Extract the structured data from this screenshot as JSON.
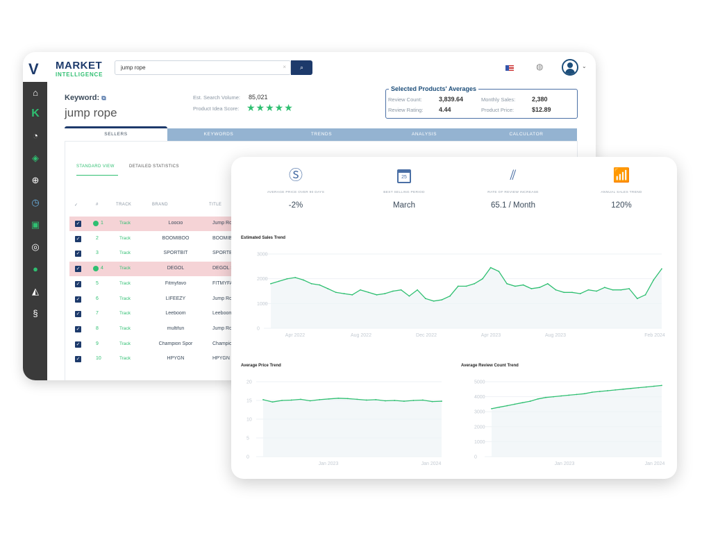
{
  "app": {
    "logo_line1": "MARKET",
    "logo_line2": "INTELLIGENCE"
  },
  "search": {
    "value": "jump rope",
    "clear_icon": "×",
    "search_icon": "magnifier"
  },
  "header": {
    "flag": "us-flag",
    "globe": "globe-icon",
    "avatar": "user-avatar"
  },
  "keyword": {
    "label": "Keyword:",
    "value": "jump rope",
    "est_search_volume_label": "Est. Search Volume:",
    "est_search_volume": "85,021",
    "product_idea_score_label": "Product Idea Score:",
    "stars": 5
  },
  "averages": {
    "title": "Selected Products' Averages",
    "review_count_label": "Review Count:",
    "review_count": "3,839.64",
    "review_rating_label": "Review Rating:",
    "review_rating": "4.44",
    "monthly_sales_label": "Monthly Sales:",
    "monthly_sales": "2,380",
    "product_price_label": "Product Price:",
    "product_price": "$12.89"
  },
  "tabs": [
    "SELLERS",
    "KEYWORDS",
    "TRENDS",
    "ANALYSIS",
    "CALCULATOR"
  ],
  "subtabs": [
    "STANDARD VIEW",
    "DETAILED STATISTICS"
  ],
  "table": {
    "headers": [
      "✓",
      "#",
      "TRACK",
      "BRAND",
      "TITLE"
    ],
    "rows": [
      {
        "n": "1",
        "track": "Track",
        "brand": "Loocio",
        "title": "Jump Rope, Tang",
        "flag": true
      },
      {
        "n": "2",
        "track": "Track",
        "brand": "BOOMIBOO",
        "title": "BOOMIBOO Jump",
        "flag": false
      },
      {
        "n": "3",
        "track": "Track",
        "brand": "SPORTBIT",
        "title": "SPORTBIT Adjust",
        "flag": false
      },
      {
        "n": "4",
        "track": "Track",
        "brand": "DEGOL",
        "title": "DEGOL Skipping",
        "flag": true
      },
      {
        "n": "5",
        "track": "Track",
        "brand": "Fitmyfavo",
        "title": "FITMYFAVO Jump",
        "flag": false
      },
      {
        "n": "6",
        "track": "Track",
        "brand": "LIFEEZY",
        "title": "Jump Rope, High",
        "flag": false
      },
      {
        "n": "7",
        "track": "Track",
        "brand": "Leeboom",
        "title": "Leeboom Jump R",
        "flag": false
      },
      {
        "n": "8",
        "track": "Track",
        "brand": "multifun",
        "title": "Jump Rope, mult",
        "flag": false
      },
      {
        "n": "9",
        "track": "Track",
        "brand": "Champion Spor",
        "title": "Champion Sports",
        "flag": false
      },
      {
        "n": "10",
        "track": "Track",
        "brand": "HPYGN",
        "title": "HPYGN Weighted",
        "flag": false
      }
    ]
  },
  "stats": [
    {
      "icon": "dollar-icon",
      "label": "AVERAGE PRICE OVER 90 DAYS",
      "value": "-2%"
    },
    {
      "icon": "calendar-icon",
      "label": "BEST SELLING PERIOD",
      "value": "March",
      "calendar_day": "25"
    },
    {
      "icon": "meteor-icon",
      "label": "RATE OF REVIEW INCREASE",
      "value": "65.1 / Month"
    },
    {
      "icon": "bar-growth-icon",
      "label": "ANNUAL SALES TREND",
      "value": "120%"
    }
  ],
  "colors": {
    "accent": "#2fbf71",
    "navy": "#1d3a6b",
    "tab_blue": "#94b3d1",
    "highlight_row": "#f5d3d6"
  },
  "chart_data": [
    {
      "type": "area",
      "title": "Estimated Sales Trend",
      "ylim": [
        0,
        3000
      ],
      "yticks": [
        "0",
        "1000",
        "2000",
        "3000"
      ],
      "xticks": [
        "Apr 2022",
        "Aug 2022",
        "Dec 2022",
        "Apr 2023",
        "Aug 2023",
        "Feb 2024"
      ],
      "grid": true,
      "x": [
        "Feb 2022",
        "Mar 2022",
        "Mar 2022",
        "Apr 2022",
        "Apr 2022",
        "May 2022",
        "May 2022",
        "Jun 2022",
        "Jun 2022",
        "Jul 2022",
        "Jul 2022",
        "Aug 2022",
        "Aug 2022",
        "Sep 2022",
        "Sep 2022",
        "Oct 2022",
        "Oct 2022",
        "Nov 2022",
        "Nov 2022",
        "Dec 2022",
        "Dec 2022",
        "Jan 2023",
        "Jan 2023",
        "Feb 2023",
        "Feb 2023",
        "Mar 2023",
        "Mar 2023",
        "Apr 2023",
        "Apr 2023",
        "May 2023",
        "May 2023",
        "Jun 2023",
        "Jun 2023",
        "Jul 2023",
        "Jul 2023",
        "Aug 2023",
        "Aug 2023",
        "Sep 2023",
        "Sep 2023",
        "Oct 2023",
        "Oct 2023",
        "Nov 2023",
        "Nov 2023",
        "Dec 2023",
        "Dec 2023",
        "Jan 2024",
        "Jan 2024",
        "Feb 2024",
        "Feb 2024"
      ],
      "values": [
        1800,
        1900,
        2000,
        2050,
        1950,
        1800,
        1750,
        1600,
        1450,
        1400,
        1350,
        1550,
        1450,
        1350,
        1400,
        1500,
        1550,
        1300,
        1550,
        1200,
        1100,
        1150,
        1300,
        1700,
        1700,
        1800,
        2000,
        2450,
        2300,
        1800,
        1700,
        1750,
        1600,
        1650,
        1800,
        1550,
        1450,
        1450,
        1400,
        1550,
        1500,
        1650,
        1550,
        1550,
        1600,
        1200,
        1350,
        1950,
        2400
      ]
    },
    {
      "type": "area",
      "title": "Average Price Trend",
      "ylim": [
        0,
        20
      ],
      "yticks": [
        "0",
        "5",
        "10",
        "15",
        "20"
      ],
      "xticks": [
        "Jan 2023",
        "Jan 2024"
      ],
      "grid": true,
      "x": [
        "Jun 2022",
        "Jul 2022",
        "Aug 2022",
        "Sep 2022",
        "Oct 2022",
        "Nov 2022",
        "Dec 2022",
        "Jan 2023",
        "Feb 2023",
        "Mar 2023",
        "Apr 2023",
        "May 2023",
        "Jun 2023",
        "Jul 2023",
        "Aug 2023",
        "Sep 2023",
        "Oct 2023",
        "Nov 2023",
        "Dec 2023",
        "Jan 2024"
      ],
      "values": [
        15.2,
        14.6,
        15,
        15.1,
        15.3,
        14.9,
        15.2,
        15.4,
        15.6,
        15.5,
        15.3,
        15.1,
        15.2,
        14.9,
        15,
        14.8,
        15,
        15.1,
        14.7,
        14.8
      ]
    },
    {
      "type": "area",
      "title": "Average Review Count Trend",
      "ylim": [
        0,
        5000
      ],
      "yticks": [
        "0",
        "1000",
        "2000",
        "3000",
        "4000",
        "5000"
      ],
      "xticks": [
        "Jan 2023",
        "Jan 2024"
      ],
      "grid": true,
      "x": [
        "Mar 2022",
        "Apr 2022",
        "May 2022",
        "Jun 2022",
        "Jul 2022",
        "Aug 2022",
        "Sep 2022",
        "Oct 2022",
        "Nov 2022",
        "Dec 2022",
        "Jan 2023",
        "Feb 2023",
        "Mar 2023",
        "Apr 2023",
        "May 2023",
        "Jun 2023",
        "Jul 2023",
        "Aug 2023",
        "Sep 2023",
        "Oct 2023",
        "Nov 2023",
        "Dec 2023",
        "Jan 2024"
      ],
      "values": [
        3200,
        3300,
        3400,
        3500,
        3600,
        3700,
        3850,
        3950,
        4000,
        4050,
        4100,
        4150,
        4200,
        4300,
        4350,
        4400,
        4450,
        4500,
        4550,
        4600,
        4650,
        4700,
        4750
      ]
    }
  ]
}
